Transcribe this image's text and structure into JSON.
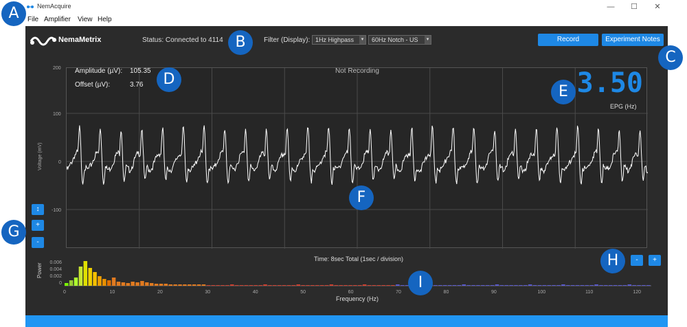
{
  "window": {
    "title": "NemAcquire",
    "minimize": "—",
    "maximize": "☐",
    "close": "✕"
  },
  "menu": [
    "File",
    "Amplifier",
    "View",
    "Help"
  ],
  "header": {
    "logo_text": "NemaMetrix",
    "status": "Status: Connected to 4114",
    "filter_label": "Filter (Display):",
    "filter1": "1Hz Highpass",
    "filter2": "60Hz Notch - US",
    "record_label": "Record",
    "notes_label": "Experiment Notes"
  },
  "plot": {
    "amplitude_label": "Amplitude (µV):",
    "amplitude_value": "105.35",
    "offset_label": "Offset (µV):",
    "offset_value": "3.76",
    "not_recording": "Not Recording",
    "rate": "3.50",
    "rate_label": "EPG (Hz)",
    "y_label": "Voltage (mV)",
    "y_ticks": [
      "200",
      "100",
      "0",
      "-100"
    ],
    "time_label": "Time: 8sec Total (1sec / division)"
  },
  "controls": {
    "fit": "↕",
    "zoom_in": "+",
    "zoom_out": "-",
    "minus": "-",
    "plus": "+"
  },
  "spectrum": {
    "y_label": "Power",
    "x_label": "Frequency (Hz)",
    "y_ticks": [
      "0.006",
      "0.004",
      "0.002",
      "0"
    ],
    "x_ticks": [
      "0",
      "10",
      "20",
      "30",
      "40",
      "50",
      "60",
      "70",
      "80",
      "90",
      "100",
      "110",
      "120"
    ]
  },
  "badges": [
    "A",
    "B",
    "C",
    "D",
    "E",
    "F",
    "G",
    "H",
    "I"
  ],
  "colors": {
    "accent": "#1e88e5",
    "badge": "#1565c0",
    "panel": "#2b2b2b"
  }
}
